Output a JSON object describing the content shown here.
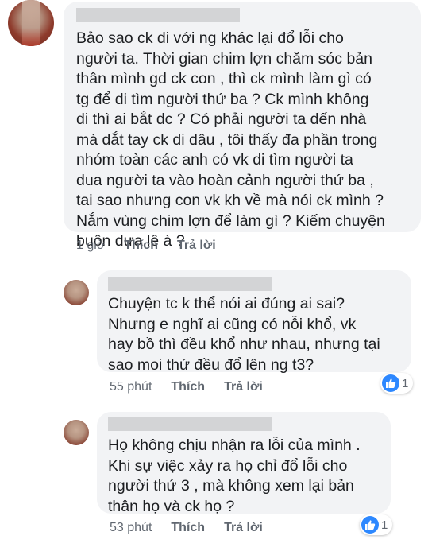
{
  "comment": {
    "text": "Bảo sao ck di với ng khác lại đổ lỗi cho\nngười ta. Thời gian chim lợn chăm sóc bản\nthân mình gd ck con , thì ck mình làm gì có\ntg để di tìm người thứ ba ? Ck mình không\ndi thì ai bắt dc ? Có phải người ta dến nhà\nmà dắt tay ck di dâu , tôi thấy đa phần trong\nnhóm toàn các anh có vk di tìm người ta\ndua người ta vào hoàn cảnh người thứ ba ,\ntai sao nhưng con vk kh về mà nói ck mình ?\nNắm vùng chim lợn để làm gì ? Kiếm chuyện\nbuôn dưa lê à ?",
    "time": "1 giờ",
    "like_label": "Thích",
    "reply_label": "Trả lời"
  },
  "replies": [
    {
      "text": "Chuyện tc k thể nói ai đúng ai sai?\nNhưng e nghĩ ai cũng có nỗi khổ, vk\nhay bồ thì đều khổ như nhau, nhưng tại\nsao moi thứ đều  đổ lên ng t3?",
      "time": "55 phút",
      "like_label": "Thích",
      "reply_label": "Trả lời",
      "reaction_count": "1"
    },
    {
      "text": "Họ không chịu nhận ra lỗi của mình .\nKhi sự việc xảy ra họ chỉ đổ lỗi cho\nngười thứ 3 , mà không xem lại bản\nthân họ và ck họ ?",
      "time": "53 phút",
      "like_label": "Thích",
      "reply_label": "Trả lời",
      "reaction_count": "1"
    }
  ],
  "colors": {
    "bubble": "#f2f3f5",
    "meta": "#606770",
    "like_blue": "#2d88ff"
  }
}
